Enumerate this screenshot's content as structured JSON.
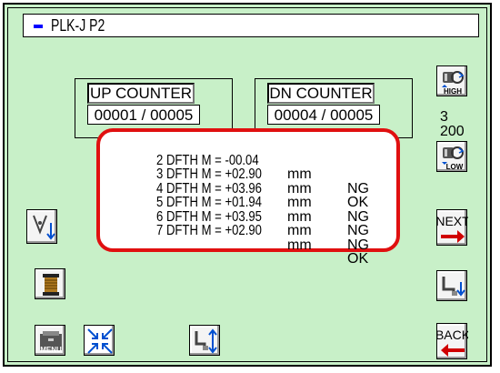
{
  "title_bar": {
    "text": "PLK-J  P2"
  },
  "up_counter": {
    "label": "UP COUNTER",
    "value": "00001 / 00005"
  },
  "dn_counter": {
    "label": "DN COUNTER",
    "value": "00004 / 00005"
  },
  "results": {
    "rows": [
      {
        "line": "2 DFTH M = -00.04",
        "unit": "mm",
        "status": "NG"
      },
      {
        "line": "3 DFTH M = +02.90",
        "unit": "mm",
        "status": "OK"
      },
      {
        "line": "4 DFTH M = +03.96",
        "unit": "mm",
        "status": "NG"
      },
      {
        "line": "5 DFTH M = +01.94",
        "unit": "mm",
        "status": "NG"
      },
      {
        "line": "6 DFTH M = +03.95",
        "unit": "mm",
        "status": "NG"
      },
      {
        "line": "7 DFTH M = +02.90",
        "unit": "mm",
        "status": "OK"
      }
    ]
  },
  "side_panel": {
    "high_label": "HIGH",
    "low_label": "LOW",
    "step_value": "3",
    "speed_value": "200",
    "next_label": "NEXT",
    "back_label": "BACK"
  },
  "bottom_bar": {
    "menu_label": "MENU"
  },
  "colors": {
    "background": "#c8f0c8",
    "result_border": "#e01010",
    "arrow_red": "#d00000",
    "arrow_blue": "#0050d0"
  }
}
